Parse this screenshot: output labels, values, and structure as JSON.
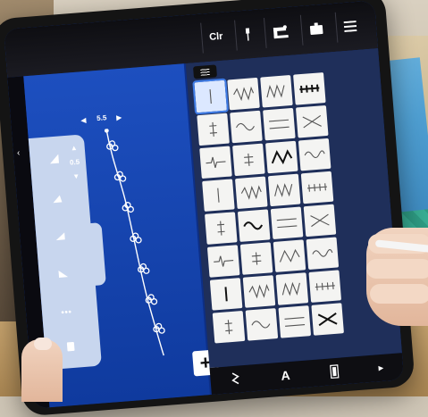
{
  "topbar": {
    "clr_label": "Clr",
    "icons": [
      "needle-icon",
      "sewing-machine-icon",
      "tablet-mode-icon",
      "menu-icon"
    ]
  },
  "editor": {
    "width_value": "5.5",
    "length_value": "0.5",
    "plus_label": "+"
  },
  "stitch_grid": {
    "rows": 8,
    "cols": 4,
    "selected_index": 0
  },
  "bottombar": {
    "items": [
      "stitch-icon",
      "alphabet-icon",
      "buttonhole-icon",
      "more-icon"
    ],
    "alphabet_label": "A",
    "more_label": "▸"
  },
  "colors": {
    "screen_blue": "#0d2f86",
    "panel_blue": "#1d4fbf",
    "grid_panel": "#1f2f5a",
    "accent": "#3f7de8"
  }
}
